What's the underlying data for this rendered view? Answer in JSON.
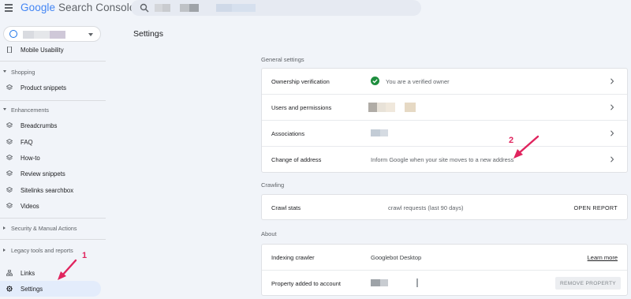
{
  "header": {
    "app_title_google": "Google",
    "app_title_rest": " Search Console"
  },
  "sidebar": {
    "items": [
      {
        "label": "Mobile Usability",
        "icon": "phone-icon"
      },
      {
        "label": "Product snippets",
        "icon": "layers-icon"
      },
      {
        "label": "Breadcrumbs",
        "icon": "layers-icon"
      },
      {
        "label": "FAQ",
        "icon": "layers-icon"
      },
      {
        "label": "How-to",
        "icon": "layers-icon"
      },
      {
        "label": "Review snippets",
        "icon": "layers-icon"
      },
      {
        "label": "Sitelinks searchbox",
        "icon": "layers-icon"
      },
      {
        "label": "Videos",
        "icon": "layers-icon"
      },
      {
        "label": "Links",
        "icon": "links-icon"
      },
      {
        "label": "Settings",
        "icon": "gear-icon"
      }
    ],
    "sections": {
      "shopping": "Shopping",
      "enhancements": "Enhancements",
      "security": "Security & Manual Actions",
      "legacy": "Legacy tools and reports"
    }
  },
  "main": {
    "title": "Settings",
    "general": {
      "label": "General settings",
      "ownership_label": "Ownership verification",
      "ownership_value": "You are a verified owner",
      "users_label": "Users and permissions",
      "associations_label": "Associations",
      "address_label": "Change of address",
      "address_value": "Inform Google when your site moves to a new address"
    },
    "crawling": {
      "label": "Crawling",
      "stats_label": "Crawl stats",
      "stats_value": "crawl requests (last 90 days)",
      "open_report": "OPEN REPORT"
    },
    "about": {
      "label": "About",
      "indexing_label": "Indexing crawler",
      "indexing_value": "Googlebot Desktop",
      "learn_more": "Learn more",
      "property_added_label": "Property added to account",
      "remove_property": "REMOVE PROPERTY"
    }
  },
  "annotations": {
    "one": "1",
    "two": "2"
  },
  "colors": {
    "accent": "#1a73e8",
    "verified": "#1e8e3e",
    "annotation": "#e0245e",
    "active_nav": "#e3ecfb"
  }
}
